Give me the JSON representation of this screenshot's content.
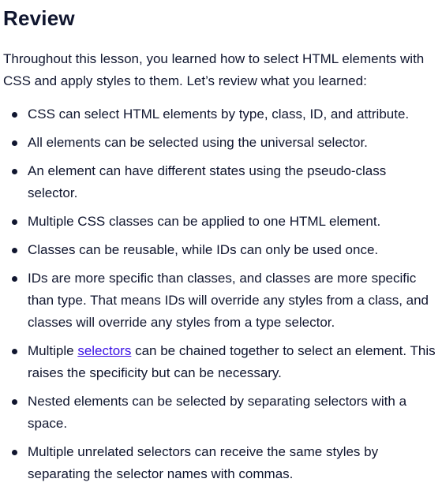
{
  "title": "Review",
  "intro": "Throughout this lesson, you learned how to select HTML elements with CSS and apply styles to them. Let’s review what you learned:",
  "items": [
    {
      "text": "CSS can select HTML elements by type, class, ID, and attribute."
    },
    {
      "text": "All elements can be selected using the universal selector."
    },
    {
      "text": "An element can have different states using the pseudo-class selector."
    },
    {
      "text": "Multiple CSS classes can be applied to one HTML element."
    },
    {
      "text": "Classes can be reusable, while IDs can only be used once."
    },
    {
      "text": "IDs are more specific than classes, and classes are more specific than type. That means IDs will override any styles from a class, and classes will override any styles from a type selector."
    },
    {
      "before": "Multiple ",
      "link": "selectors",
      "after": " can be chained together to select an element. This raises the specificity but can be necessary."
    },
    {
      "text": "Nested elements can be selected by separating selectors with a space."
    },
    {
      "text": "Multiple unrelated selectors can receive the same styles by separating the selector names with commas."
    }
  ]
}
